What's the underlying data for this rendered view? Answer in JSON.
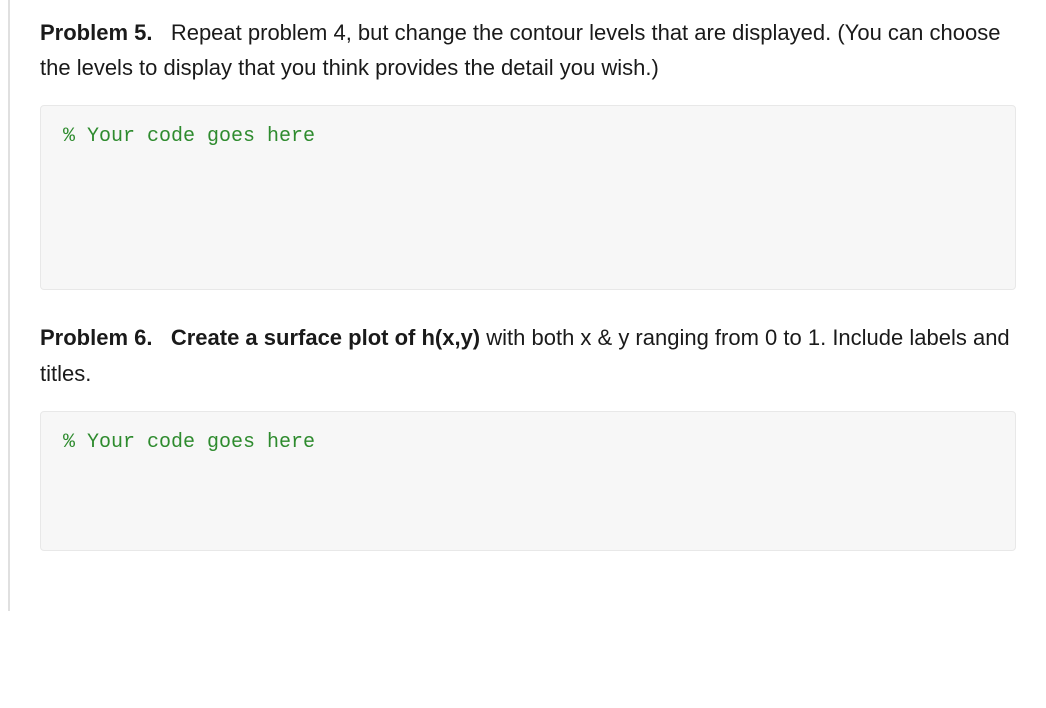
{
  "problems": [
    {
      "label": "Problem 5.",
      "title_bold": "",
      "text": "Repeat problem 4, but change the contour levels that are displayed.  (You can choose the levels to display that you think provides the detail you wish.)",
      "code_comment": "% Your code goes here",
      "block_class": ""
    },
    {
      "label": "Problem 6.",
      "title_bold": "Create a surface plot of h(x,y)",
      "text": " with both x & y ranging from 0 to 1.  Include labels and titles.",
      "code_comment": "% Your code goes here",
      "block_class": "short"
    }
  ]
}
